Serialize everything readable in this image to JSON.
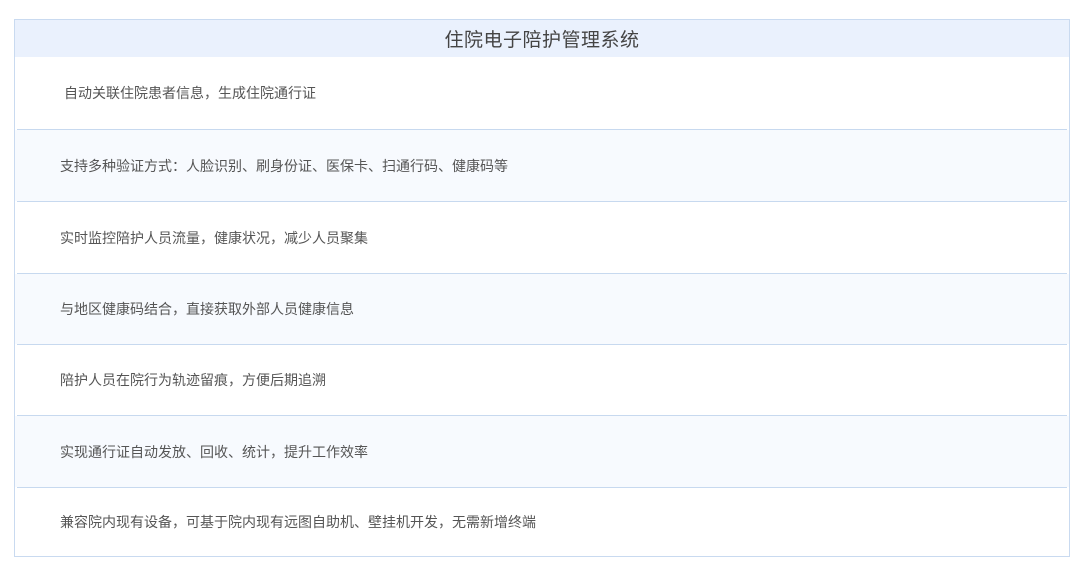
{
  "panel": {
    "title": "住院电子陪护管理系统",
    "features": [
      {
        "text": "自动关联住院患者信息，生成住院通行证",
        "bg": "#ffffff"
      },
      {
        "text": "支持多种验证方式：人脸识别、刷身份证、医保卡、扫通行码、健康码等",
        "bg": "#f7fafe"
      },
      {
        "text": "实时监控陪护人员流量，健康状况，减少人员聚集",
        "bg": "#ffffff"
      },
      {
        "text": "与地区健康码结合，直接获取外部人员健康信息",
        "bg": "#f7fafe"
      },
      {
        "text": "陪护人员在院行为轨迹留痕，方便后期追溯",
        "bg": "#ffffff"
      },
      {
        "text": "实现通行证自动发放、回收、统计，提升工作效率",
        "bg": "#f7fafe"
      },
      {
        "text": "兼容院内现有设备，可基于院内现有远图自助机、壁挂机开发，无需新增终端",
        "bg": "#ffffff"
      }
    ]
  },
  "colors": {
    "header_bg": "#eaf1fd",
    "border": "#c9daf0",
    "divider": "#c7d9ef",
    "text": "#555555",
    "title_text": "#444444"
  }
}
